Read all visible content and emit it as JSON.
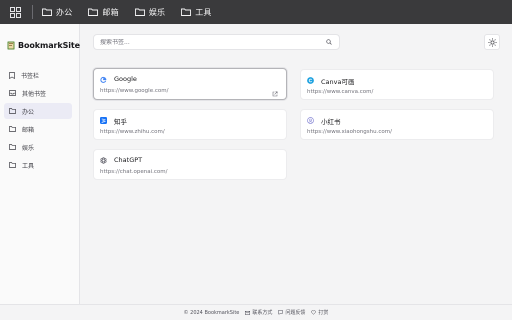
{
  "topbar": {
    "items": [
      {
        "label": "办公",
        "icon": "folder-icon"
      },
      {
        "label": "邮箱",
        "icon": "folder-icon"
      },
      {
        "label": "娱乐",
        "icon": "folder-icon"
      },
      {
        "label": "工具",
        "icon": "folder-icon"
      }
    ]
  },
  "sidebar": {
    "brand": "BookmarkSite",
    "items": [
      {
        "label": "书签栏",
        "icon": "bookmark-icon",
        "active": false
      },
      {
        "label": "其他书签",
        "icon": "inbox-icon",
        "active": false
      },
      {
        "label": "办公",
        "icon": "folder-icon",
        "active": true
      },
      {
        "label": "邮箱",
        "icon": "folder-icon",
        "active": false
      },
      {
        "label": "娱乐",
        "icon": "folder-icon",
        "active": false
      },
      {
        "label": "工具",
        "icon": "folder-icon",
        "active": false
      }
    ]
  },
  "search": {
    "placeholder": "搜索书签..."
  },
  "bookmarks": [
    {
      "name": "Google",
      "url": "https://www.google.com/",
      "icon": "google-icon",
      "selected": true
    },
    {
      "name": "Canva可画",
      "url": "https://www.canva.com/",
      "icon": "canva-icon",
      "selected": false
    },
    {
      "name": "知乎",
      "url": "https://www.zhihu.com/",
      "icon": "zhihu-icon",
      "selected": false
    },
    {
      "name": "小红书",
      "url": "https://www.xiaohongshu.com/",
      "icon": "xiaohongshu-icon",
      "selected": false
    },
    {
      "name": "ChatGPT",
      "url": "https://chat.openai.com/",
      "icon": "chatgpt-icon",
      "selected": false
    }
  ],
  "footer": {
    "copyright": "© 2024 BookmarkSite",
    "contact": "联系方式",
    "feedback": "问题反馈",
    "donate": "打赏"
  },
  "colors": {
    "topbar": "#3a3a3c",
    "active_item": "#ebebf5",
    "canva": "#1fa2e0",
    "zhihu": "#1772f6"
  }
}
